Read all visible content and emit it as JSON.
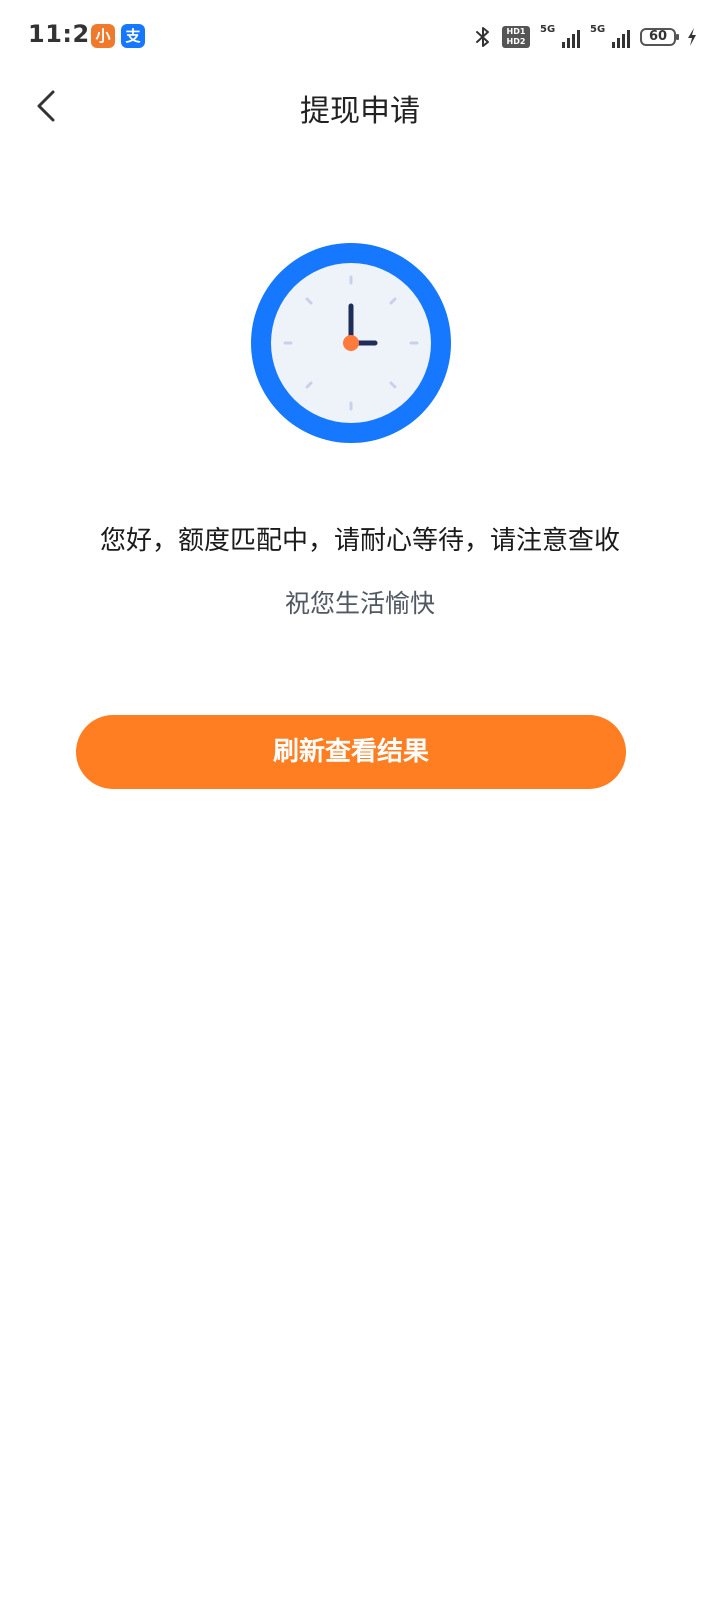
{
  "status_bar": {
    "time": "11:20",
    "app_icons": [
      "小",
      "支"
    ],
    "hd_badge": "HD1 HD2",
    "signal_1": "5G",
    "signal_2": "5G",
    "battery": "60"
  },
  "nav": {
    "title": "提现申请",
    "back_icon": "chevron-left-icon"
  },
  "illustration": {
    "icon": "clock-icon",
    "ring_color": "#1677ff",
    "face_color": "#eef3fa",
    "hand_color": "#1f2d5a",
    "center_dot_color": "#ff7a3d"
  },
  "content": {
    "message": "您好，额度匹配中，请耐心等待，请注意查收",
    "sub_message": "祝您生活愉快"
  },
  "actions": {
    "refresh_label": "刷新查看结果",
    "refresh_color": "#ff7e21"
  }
}
